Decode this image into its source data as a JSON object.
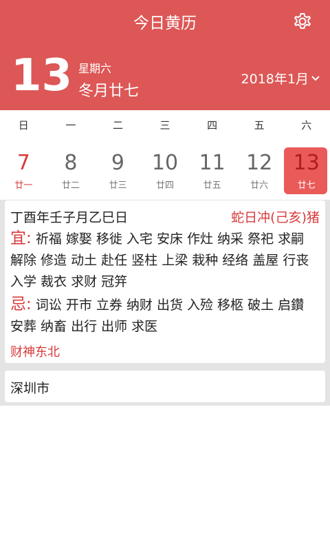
{
  "header": {
    "title": "今日黄历",
    "day": "13",
    "weekday": "星期六",
    "lunar_date": "冬月廿七",
    "month_picker": "2018年1月"
  },
  "week_days": [
    "日",
    "一",
    "二",
    "三",
    "四",
    "五",
    "六"
  ],
  "days": [
    {
      "num": "7",
      "lunar": "廿一"
    },
    {
      "num": "8",
      "lunar": "廿二"
    },
    {
      "num": "9",
      "lunar": "廿三"
    },
    {
      "num": "10",
      "lunar": "廿四"
    },
    {
      "num": "11",
      "lunar": "廿五"
    },
    {
      "num": "12",
      "lunar": "廿六"
    },
    {
      "num": "13",
      "lunar": "廿七"
    }
  ],
  "almanac": {
    "ganzhi": "丁酉年壬子月乙巳日",
    "chong": "蛇日冲(己亥)猪",
    "yi_label": "宜:",
    "yi_text": "祈福 嫁娶 移徙 入宅 安床 作灶 纳采 祭祀 求嗣 解除 修造 动土 赴任 竖柱 上梁 栽种 经络 盖屋 行丧 入学 裁衣 求财 冠笄",
    "ji_label": "忌:",
    "ji_text": "词讼 开市 立券 纳财 出货 入殓 移柩 破土 启鑽 安葬 纳畜 出行 出师 求医",
    "caishen": "财神东北"
  },
  "city": "深圳市",
  "colors": {
    "header": "#dc5756",
    "accent_red": "#d83a3a",
    "selected": "#ea5a58"
  }
}
